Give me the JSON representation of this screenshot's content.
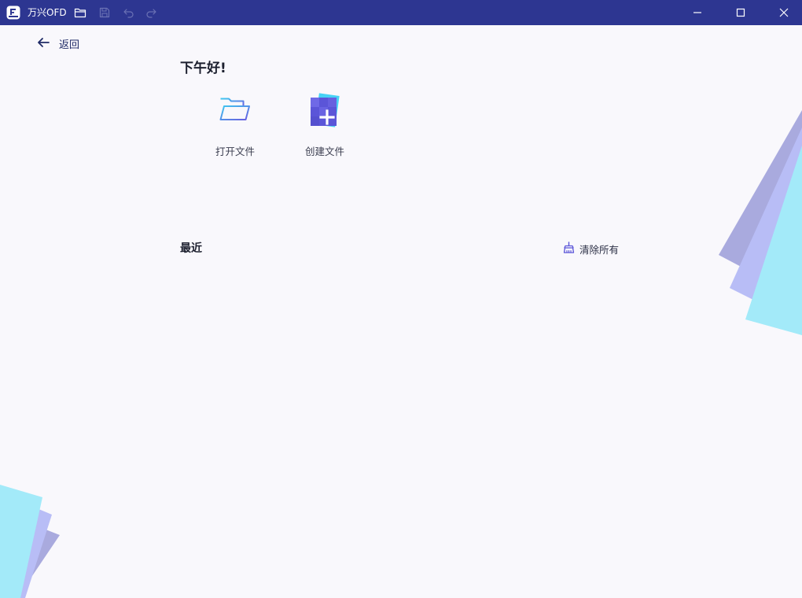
{
  "titlebar": {
    "app_name": "万兴OFD",
    "icons": [
      "app-logo",
      "open-folder-icon",
      "save-icon",
      "undo-icon",
      "redo-icon"
    ],
    "window_controls": [
      "minimize-icon",
      "maximize-icon",
      "close-icon"
    ]
  },
  "nav": {
    "back_label": "返回"
  },
  "home": {
    "greeting": "下午好!",
    "actions": [
      {
        "label": "打开文件",
        "icon": "open-file-icon"
      },
      {
        "label": "创建文件",
        "icon": "create-file-icon"
      }
    ],
    "recent_title": "最近",
    "clear_all_label": "清除所有"
  },
  "colors": {
    "titlebar_bg": "#2d3691",
    "page_bg": "#f9f8fc",
    "accent_purple": "#5b55d8",
    "accent_cyan": "#3fc7f0",
    "deco_cyan": "#a3eaf9",
    "deco_periwinkle": "#b8bdf6",
    "deco_lavender": "#a9aade"
  }
}
